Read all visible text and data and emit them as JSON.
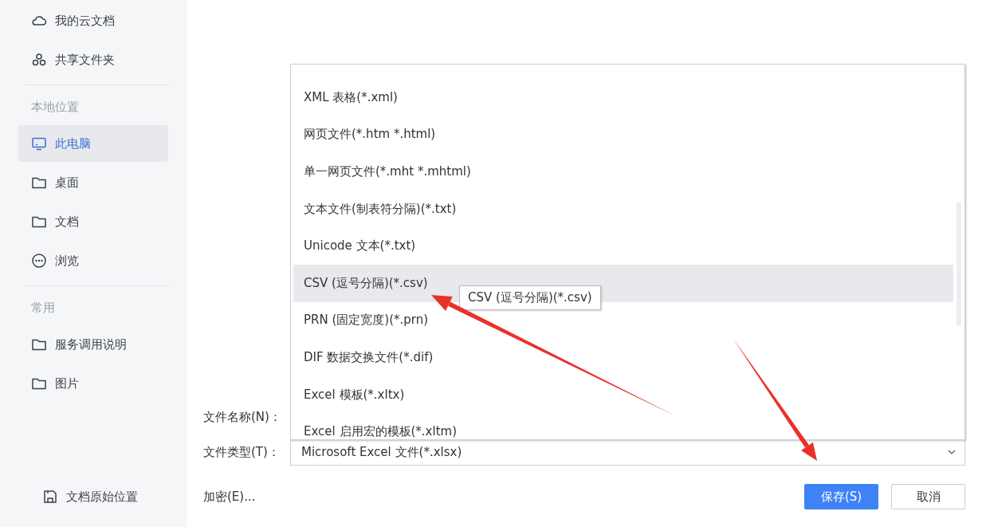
{
  "sidebar": {
    "groups": [
      {
        "items": [
          {
            "label": "我的云文档",
            "kind": "cloud",
            "selected": false
          },
          {
            "label": "共享文件夹",
            "kind": "share",
            "selected": false
          }
        ]
      },
      {
        "heading": "本地位置",
        "items": [
          {
            "label": "此电脑",
            "kind": "computer",
            "selected": true
          },
          {
            "label": "桌面",
            "kind": "folder",
            "selected": false
          },
          {
            "label": "文档",
            "kind": "folder",
            "selected": false
          },
          {
            "label": "浏览",
            "kind": "more",
            "selected": false
          }
        ]
      },
      {
        "heading": "常用",
        "items": [
          {
            "label": "服务调用说明",
            "kind": "folder",
            "selected": false
          },
          {
            "label": "图片",
            "kind": "folder",
            "selected": false
          }
        ]
      }
    ],
    "footer": {
      "label": "文档原始位置"
    }
  },
  "form": {
    "filename_label": "文件名称(N)：",
    "filetype_label": "文件类型(T)：",
    "filetype_value": "Microsoft Excel 文件(*.xlsx)",
    "encrypt_link": "加密(E)..."
  },
  "buttons": [
    {
      "label": "保存(S)",
      "kind": "primary"
    },
    {
      "label": "取消",
      "kind": "default"
    }
  ],
  "dropdown": {
    "items": [
      {
        "label": "XML 表格(*.xml)",
        "selected": false
      },
      {
        "label": "网页文件(*.htm *.html)",
        "selected": false
      },
      {
        "label": "单一网页文件(*.mht *.mhtml)",
        "selected": false
      },
      {
        "label": "文本文件(制表符分隔)(*.txt)",
        "selected": false
      },
      {
        "label": "Unicode 文本(*.txt)",
        "selected": false
      },
      {
        "label": "CSV (逗号分隔)(*.csv)",
        "selected": true
      },
      {
        "label": "PRN (固定宽度)(*.prn)",
        "selected": false
      },
      {
        "label": "DIF 数据交换文件(*.dif)",
        "selected": false
      },
      {
        "label": "Excel 模板(*.xltx)",
        "selected": false
      },
      {
        "label": "Excel 启用宏的模板(*.xltm)",
        "selected": false
      }
    ],
    "tooltip": "CSV (逗号分隔)(*.csv)"
  }
}
